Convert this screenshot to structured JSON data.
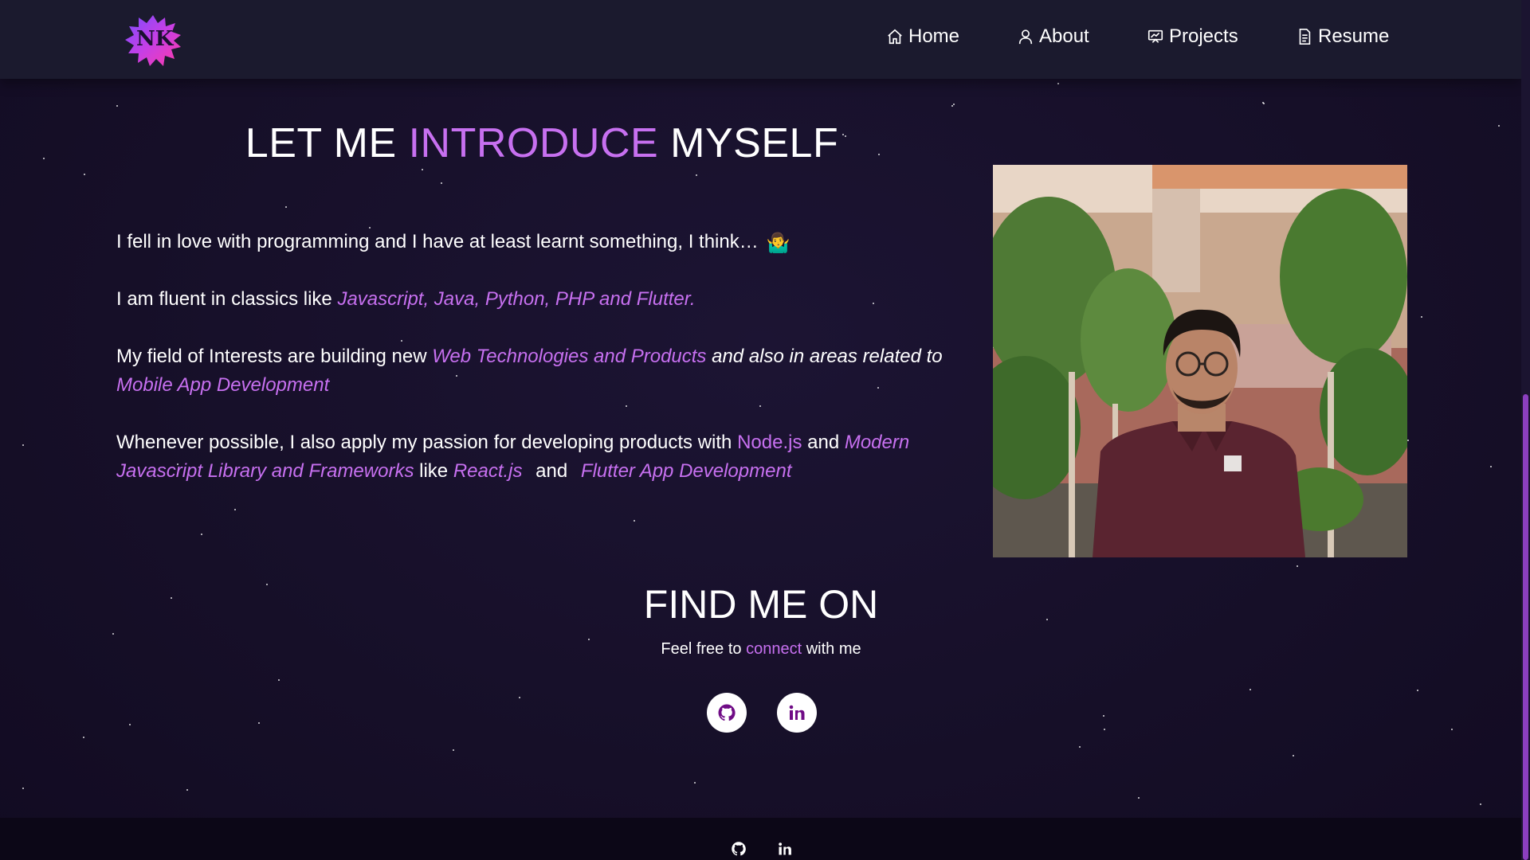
{
  "nav": {
    "logo_text": "NK",
    "items": [
      {
        "label": "Home",
        "icon": "home-icon"
      },
      {
        "label": "About",
        "icon": "user-icon"
      },
      {
        "label": "Projects",
        "icon": "presentation-icon"
      },
      {
        "label": "Resume",
        "icon": "document-icon"
      }
    ]
  },
  "about": {
    "heading_pre": "LET ME ",
    "heading_accent": "INTRODUCE",
    "heading_post": " MYSELF",
    "p1": "I fell in love with programming and I have at least learnt something, I think…",
    "p1_emoji": "🤷‍♂️",
    "p2_pre": "I am fluent in classics like ",
    "p2_accent": "Javascript, Java, Python, PHP and Flutter.",
    "p3_pre": "My field of Interests are building new ",
    "p3_accent1": "Web Technologies and Products",
    "p3_mid": " and also in areas related to ",
    "p3_accent2": "Mobile App Development",
    "p4_pre": "Whenever possible, I also apply my passion for developing products with ",
    "p4_accent1": "Node.js",
    "p4_and1": " and ",
    "p4_accent2": "Modern Javascript Library and Frameworks",
    "p4_like": " like ",
    "p4_accent3": "React.js",
    "p4_and2": " and ",
    "p4_accent4": "Flutter App Development"
  },
  "find": {
    "title": "FIND ME ON",
    "sub_pre": "Feel free to ",
    "sub_accent": "connect",
    "sub_post": " with me",
    "links": [
      {
        "icon": "github-icon"
      },
      {
        "icon": "linkedin-icon"
      }
    ]
  },
  "footer": {
    "links": [
      {
        "icon": "github-icon"
      },
      {
        "icon": "linkedin-icon"
      }
    ]
  },
  "colors": {
    "accent": "#c770f0",
    "background": "#160f28",
    "navbar": "#1b1a2e",
    "footer": "#0c0717",
    "social_icon": "#700c86"
  }
}
